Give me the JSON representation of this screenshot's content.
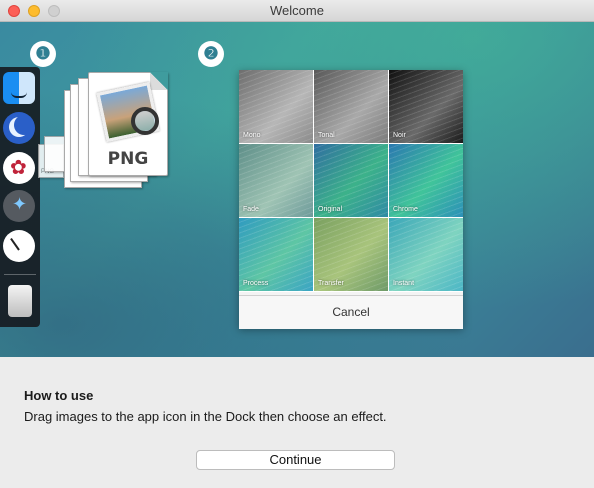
{
  "window": {
    "title": "Welcome"
  },
  "steps": {
    "one": "❶",
    "two": "❷"
  },
  "dock": {
    "items": [
      {
        "icon": "finder-icon"
      },
      {
        "icon": "moon-icon"
      },
      {
        "icon": "keychain-icon"
      },
      {
        "icon": "launchpad-icon"
      },
      {
        "icon": "clock-icon"
      },
      {
        "icon": "trash-icon"
      }
    ]
  },
  "file": {
    "label": "PNG",
    "small_label": "PNG"
  },
  "effects": {
    "tiles": [
      {
        "label": "Mono"
      },
      {
        "label": "Tonal"
      },
      {
        "label": "Noir"
      },
      {
        "label": "Fade"
      },
      {
        "label": "Original"
      },
      {
        "label": "Chrome"
      },
      {
        "label": "Process"
      },
      {
        "label": "Transfer"
      },
      {
        "label": "Instant"
      }
    ],
    "cancel_label": "Cancel"
  },
  "howto": {
    "title": "How to use",
    "text": "Drag images to the app icon in the Dock then choose an effect."
  },
  "continue_label": "Continue"
}
